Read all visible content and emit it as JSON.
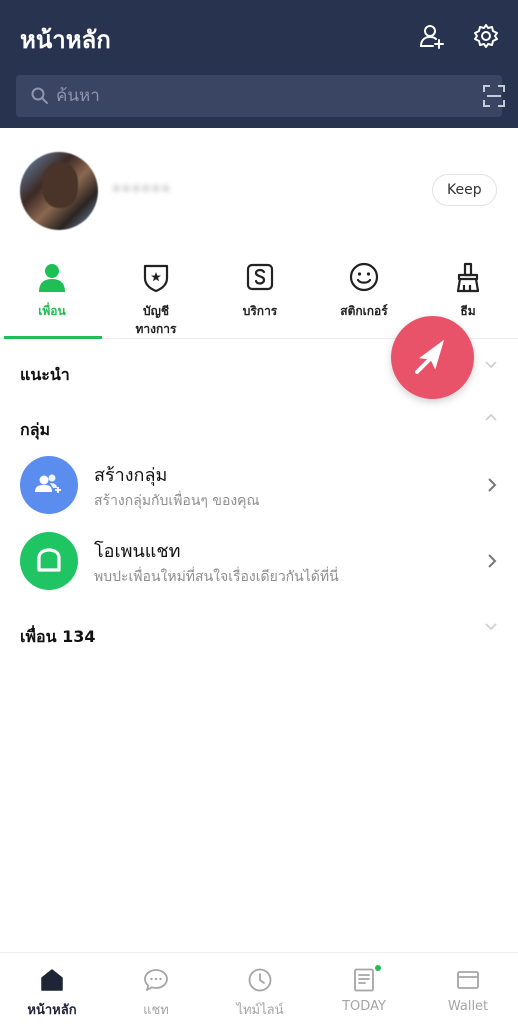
{
  "header": {
    "title": "หน้าหลัก",
    "add_friend_icon": "add-friend-icon",
    "settings_icon": "gear-icon"
  },
  "search": {
    "placeholder": "ค้นหา",
    "scan_icon": "qr-scan-icon"
  },
  "profile": {
    "name": "••••••",
    "keep_label": "Keep"
  },
  "categories": [
    {
      "label": "เพื่อน",
      "icon": "person-icon",
      "active": true
    },
    {
      "label": "บัญชี\nทางการ",
      "icon": "official-badge-icon"
    },
    {
      "label": "บริการ",
      "icon": "service-s-icon"
    },
    {
      "label": "สติกเกอร์",
      "icon": "smiley-icon"
    },
    {
      "label": "ธีม",
      "icon": "brush-icon"
    }
  ],
  "sections": {
    "recommended": "แนะนำ",
    "groups": "กลุ่ม",
    "friends": "เพื่อน 134"
  },
  "group_items": [
    {
      "title": "สร้างกลุ่ม",
      "subtitle": "สร้างกลุ่มกับเพื่อนๆ ของคุณ",
      "icon": "create-group-icon",
      "color": "#5b8def"
    },
    {
      "title": "โอเพนแชท",
      "subtitle": "พบปะเพื่อนใหม่ที่สนใจเรื่องเดียวกันได้ที่นี่",
      "icon": "openchat-icon",
      "color": "#1fc463"
    }
  ],
  "fab": {
    "icon": "arrow-cursor-icon",
    "color": "#e8536a"
  },
  "bottom_nav": [
    {
      "label": "หน้าหลัก",
      "icon": "home-icon",
      "active": true
    },
    {
      "label": "แชท",
      "icon": "chat-icon"
    },
    {
      "label": "ไทม์ไลน์",
      "icon": "clock-icon"
    },
    {
      "label": "TODAY",
      "icon": "news-icon"
    },
    {
      "label": "Wallet",
      "icon": "wallet-icon"
    }
  ],
  "colors": {
    "header_bg": "#283350",
    "accent_green": "#1fbf55"
  }
}
